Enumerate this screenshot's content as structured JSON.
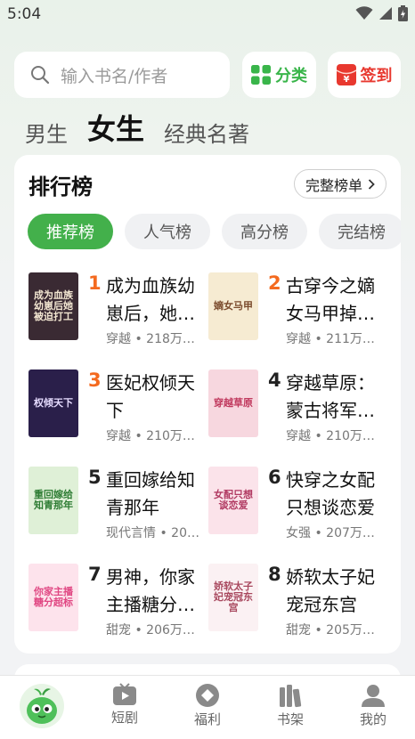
{
  "status_bar": {
    "time": "5:04"
  },
  "search": {
    "placeholder": "输入书名/作者"
  },
  "header_buttons": {
    "category": "分类",
    "signin": "签到"
  },
  "gender_tabs": [
    {
      "label": "男生",
      "active": false
    },
    {
      "label": "女生",
      "active": true
    },
    {
      "label": "经典名著",
      "active": false
    }
  ],
  "ranking": {
    "title": "排行榜",
    "full_list_label": "完整榜单",
    "chips": [
      {
        "label": "推荐榜",
        "active": true
      },
      {
        "label": "人气榜",
        "active": false
      },
      {
        "label": "高分榜",
        "active": false
      },
      {
        "label": "完结榜",
        "active": false
      }
    ],
    "books": [
      {
        "rank": "1",
        "title": "成为血族幼崽后，她…",
        "meta": "穿越 • 218万…",
        "cover_text": "成为血族幼崽后她被迫打工",
        "cover_bg": "#3a2a33",
        "cover_fg": "#f3e7d2"
      },
      {
        "rank": "2",
        "title": "古穿今之嫡女马甲掉…",
        "meta": "穿越 • 211万…",
        "cover_text": "嫡女马甲",
        "cover_bg": "#f6ebd2",
        "cover_fg": "#7a4a2c"
      },
      {
        "rank": "3",
        "title": "医妃权倾天下",
        "meta": "穿越 • 210万…",
        "cover_text": "权倾天下",
        "cover_bg": "#2a1f4a",
        "cover_fg": "#e6dcff"
      },
      {
        "rank": "4",
        "title": "穿越草原：蒙古将军…",
        "meta": "穿越 • 210万…",
        "cover_text": "穿越草原",
        "cover_bg": "#f7d7df",
        "cover_fg": "#c0395e"
      },
      {
        "rank": "5",
        "title": "重回嫁给知青那年",
        "meta": "现代言情 • 20…",
        "cover_text": "重回嫁给知青那年",
        "cover_bg": "#dff0d7",
        "cover_fg": "#2f7d35"
      },
      {
        "rank": "6",
        "title": "快穿之女配只想谈恋爱",
        "meta": "女强 • 207万…",
        "cover_text": "女配只想谈恋爱",
        "cover_bg": "#fbe3ea",
        "cover_fg": "#b13a62"
      },
      {
        "rank": "7",
        "title": "男神，你家主播糖分…",
        "meta": "甜宠 • 206万…",
        "cover_text": "你家主播糖分超标",
        "cover_bg": "#fde3ec",
        "cover_fg": "#e04682"
      },
      {
        "rank": "8",
        "title": "娇软太子妃宠冠东宫",
        "meta": "甜宠 • 205万…",
        "cover_text": "娇软太子妃宠冠东宫",
        "cover_bg": "#fbf1f3",
        "cover_fg": "#a8485e"
      }
    ]
  },
  "bottom_nav": [
    {
      "label": "短剧",
      "icon": "play-video-icon"
    },
    {
      "label": "福利",
      "icon": "diamond-gift-icon"
    },
    {
      "label": "书架",
      "icon": "bookshelf-icon"
    },
    {
      "label": "我的",
      "icon": "user-profile-icon"
    }
  ],
  "colors": {
    "accent": "#43b04b",
    "rank_highlight": "#f46a1f",
    "signin_red": "#e8382f"
  }
}
